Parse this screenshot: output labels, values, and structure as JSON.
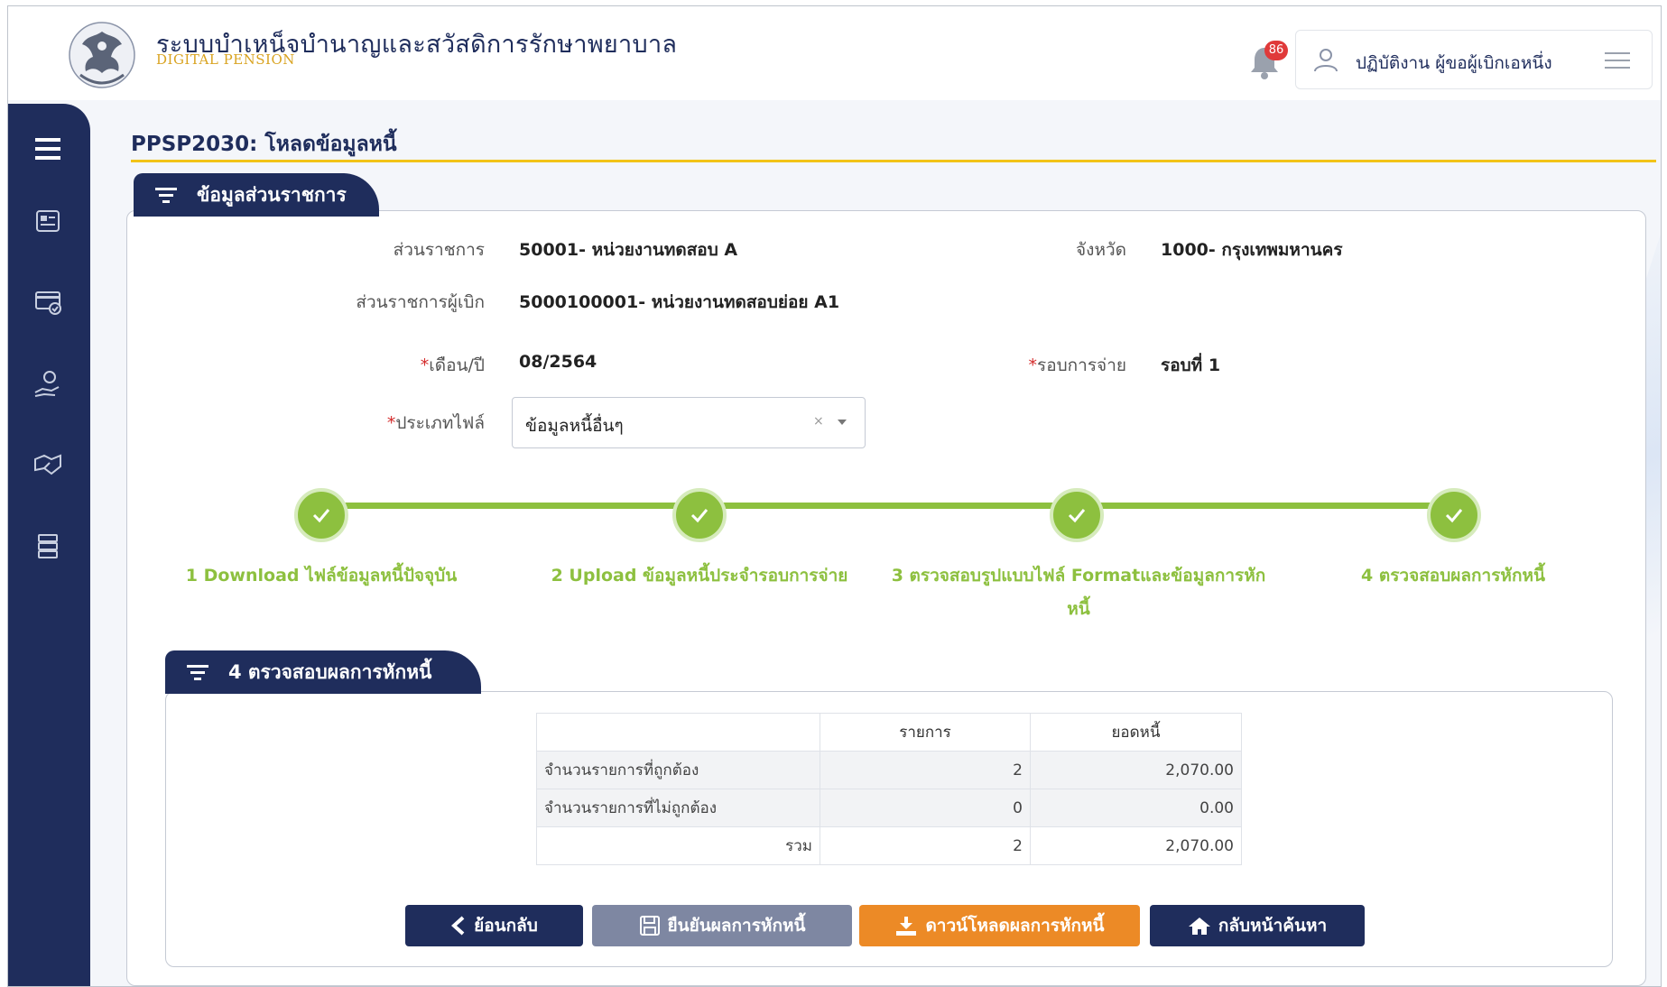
{
  "header": {
    "title": "ระบบบำเหน็จบำนาญและสวัสดิการรักษาพยาบาล",
    "subtitle": "DIGITAL PENSION",
    "notification_count": "86",
    "user_label": "ปฏิบัติงาน ผู้ขอผู้เบิกเอหนึ่ง"
  },
  "page": {
    "title": "PPSP2030: โหลดข้อมูลหนี้"
  },
  "section_main": {
    "heading": "ข้อมูลส่วนราชการ",
    "agency_label": "ส่วนราชการ",
    "agency_value": "50001- หน่วยงานทดสอบ A",
    "province_label": "จังหวัด",
    "province_value": "1000- กรุงเทพมหานคร",
    "disburse_label": "ส่วนราชการผู้เบิก",
    "disburse_value": "5000100001- หน่วยงานทดสอบย่อย A1",
    "month_label": "เดือน/ปี",
    "month_value": "08/2564",
    "round_label": "รอบการจ่าย",
    "round_value": "รอบที่ 1",
    "filetype_label": "ประเภทไฟล์",
    "filetype_value": "ข้อมูลหนี้อื่นๆ",
    "required_mark": "*",
    "clear_mark": "×"
  },
  "steps": [
    {
      "label": "1 Download ไฟล์ข้อมูลหนี้ปัจจุบัน",
      "done": true
    },
    {
      "label": "2 Upload ข้อมูลหนี้ประจำรอบการจ่าย",
      "done": true
    },
    {
      "label": "3 ตรวจสอบรูปแบบไฟล์ Formatและข้อมูลการหัก",
      "label_line2": "หนี้",
      "done": true
    },
    {
      "label": "4 ตรวจสอบผลการหักหนี้",
      "done": true
    }
  ],
  "section_result": {
    "heading": "4 ตรวจสอบผลการหักหนี้",
    "table": {
      "headers": [
        "",
        "รายการ",
        "ยอดหนี้"
      ],
      "rows": [
        {
          "label": "จำนวนรายการที่ถูกต้อง",
          "count": "2",
          "amount": "2,070.00"
        },
        {
          "label": "จำนวนรายการที่ไม่ถูกต้อง",
          "count": "0",
          "amount": "0.00"
        },
        {
          "label": "รวม",
          "count": "2",
          "amount": "2,070.00"
        }
      ]
    }
  },
  "buttons": {
    "back": "ย้อนกลับ",
    "confirm": "ยืนยันผลการหักหนี้",
    "download": "ดาวน์โหลดผลการหักหนี้",
    "home": "กลับหน้าค้นหา"
  },
  "colors": {
    "navy": "#1f2d5c",
    "accent_yellow": "#f2c318",
    "step_green": "#8dc03f",
    "download_orange": "#ec8a26",
    "confirm_grey": "#7e87a2",
    "badge_red": "#e03a3a"
  }
}
